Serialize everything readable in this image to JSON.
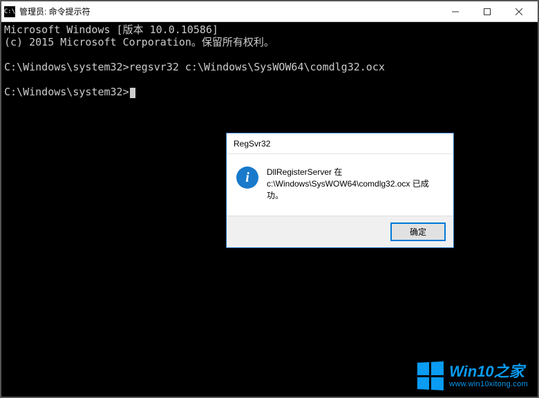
{
  "cmd": {
    "title": "管理员: 命令提示符",
    "icon_label": "C:\\",
    "lines": {
      "l1": "Microsoft Windows [版本 10.0.10586]",
      "l2": "(c) 2015 Microsoft Corporation。保留所有权利。",
      "l3": "",
      "l4": "C:\\Windows\\system32>regsvr32 c:\\Windows\\SysWOW64\\comdlg32.ocx",
      "l5": "",
      "l6_prompt": "C:\\Windows\\system32>"
    }
  },
  "dialog": {
    "title": "RegSvr32",
    "icon_glyph": "i",
    "message_line1": "DllRegisterServer 在",
    "message_line2": "c:\\Windows\\SysWOW64\\comdlg32.ocx 已成功。",
    "ok_label": "确定"
  },
  "watermark": {
    "title": "Win10之家",
    "url": "www.win10xitong.com"
  }
}
